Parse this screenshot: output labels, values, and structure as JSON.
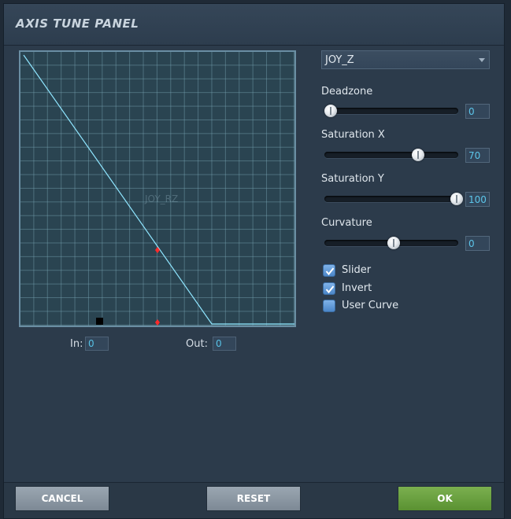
{
  "title": "AXIS TUNE PANEL",
  "graph": {
    "axis_watermark": "JOY_RZ",
    "in_label": "In:",
    "in_value": "0",
    "out_label": "Out:",
    "out_value": "0",
    "line_color": "#8fe6ff",
    "marker_color": "#ff2a2a"
  },
  "axis_select": {
    "value": "JOY_Z"
  },
  "sliders": [
    {
      "label": "Deadzone",
      "value": "0",
      "level": 0
    },
    {
      "label": "Saturation X",
      "value": "70",
      "level": 70
    },
    {
      "label": "Saturation Y",
      "value": "100",
      "level": 100
    },
    {
      "label": "Curvature",
      "value": "0",
      "level": 50
    }
  ],
  "checkboxes": [
    {
      "label": "Slider",
      "checked": true
    },
    {
      "label": "Invert",
      "checked": true
    },
    {
      "label": "User Curve",
      "checked": false
    }
  ],
  "buttons": {
    "cancel": "CANCEL",
    "reset": "RESET",
    "ok": "OK"
  }
}
